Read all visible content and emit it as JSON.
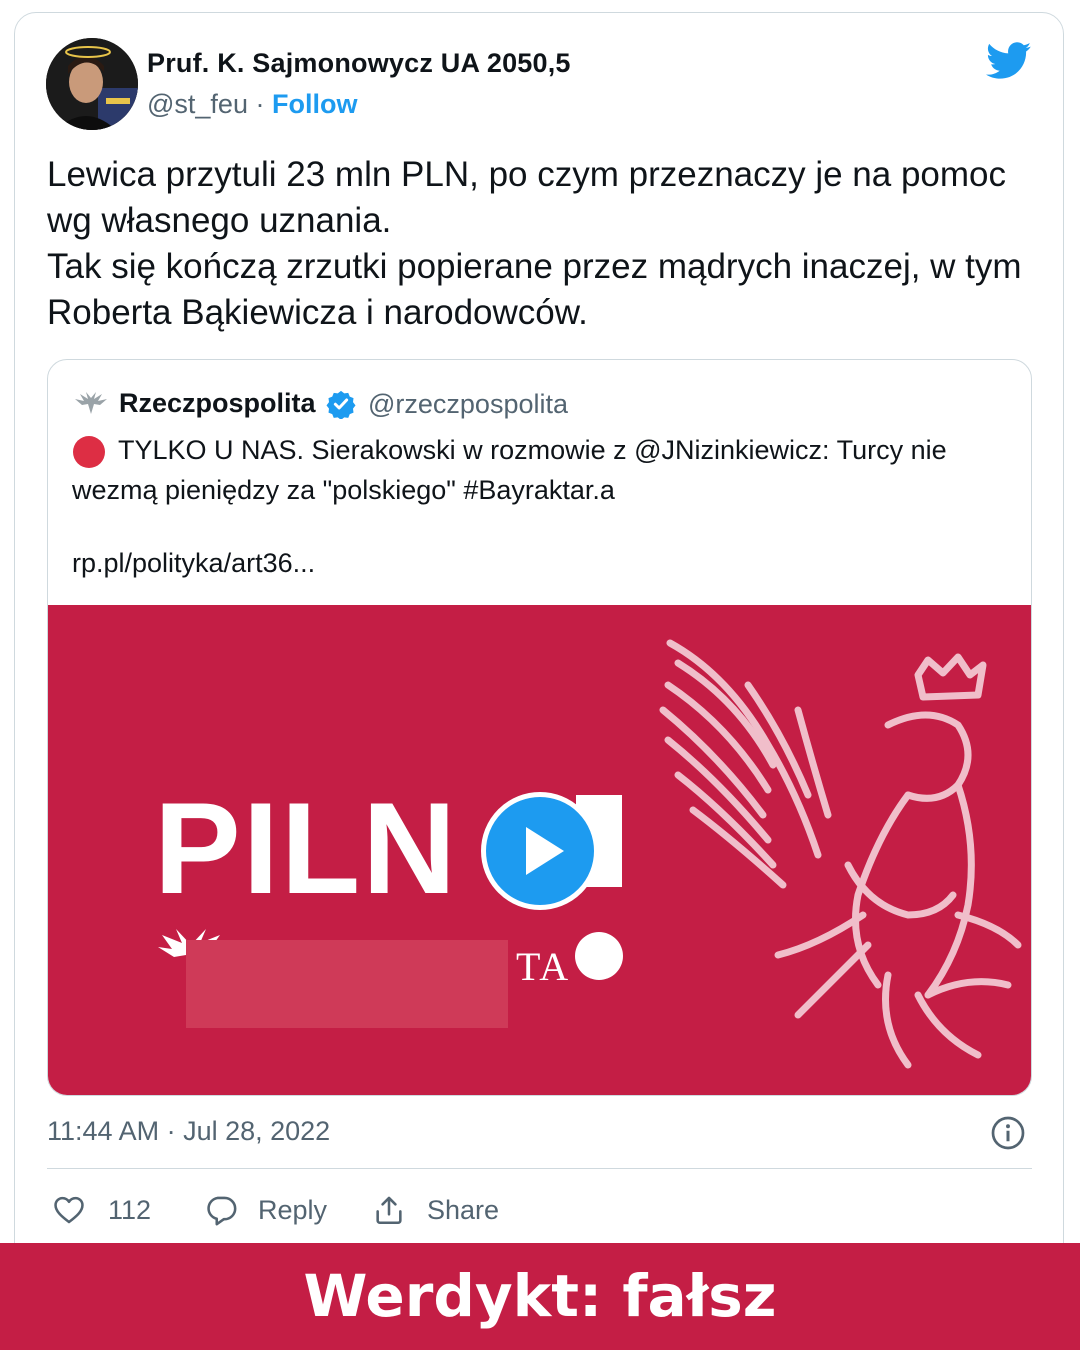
{
  "author": {
    "display_name": "Pruf. K. Sajmonowycz UA 2050,5",
    "handle": "@st_feu",
    "separator": " · ",
    "follow_label": "Follow"
  },
  "tweet": {
    "text": "Lewica przytuli 23 mln PLN, po czym przeznaczy je na pomoc wg własnego uznania.\nTak się kończą zrzutki popierane przez mądrych inaczej, w tym Roberta Bąkiewicza i narodowców."
  },
  "quoted_tweet": {
    "display_name": "Rzeczpospolita",
    "handle": "@rzeczpospolita",
    "verified": true,
    "text": "TYLKO U NAS. Sierakowski w rozmowie z @JNizinkiewicz: Turcy nie wezmą pieniędzy za \"polskiego\" #Bayraktar.a",
    "link": "rp.pl/polityka/art36...",
    "media": {
      "headline": "PILN",
      "brand_fragment": "TA",
      "background_color": "#c41e45",
      "media_type": "video"
    }
  },
  "meta": {
    "timestamp": "11:44 AM · Jul 28, 2022"
  },
  "actions": {
    "like_count": "112",
    "reply_label": "Reply",
    "share_label": "Share"
  },
  "verdict": {
    "text": "Werdykt: fałsz",
    "background_color": "#c41e45"
  },
  "icons": [
    "twitter-bird-icon",
    "verified-badge-icon",
    "play-icon",
    "info-icon",
    "heart-icon",
    "reply-icon",
    "share-icon"
  ]
}
